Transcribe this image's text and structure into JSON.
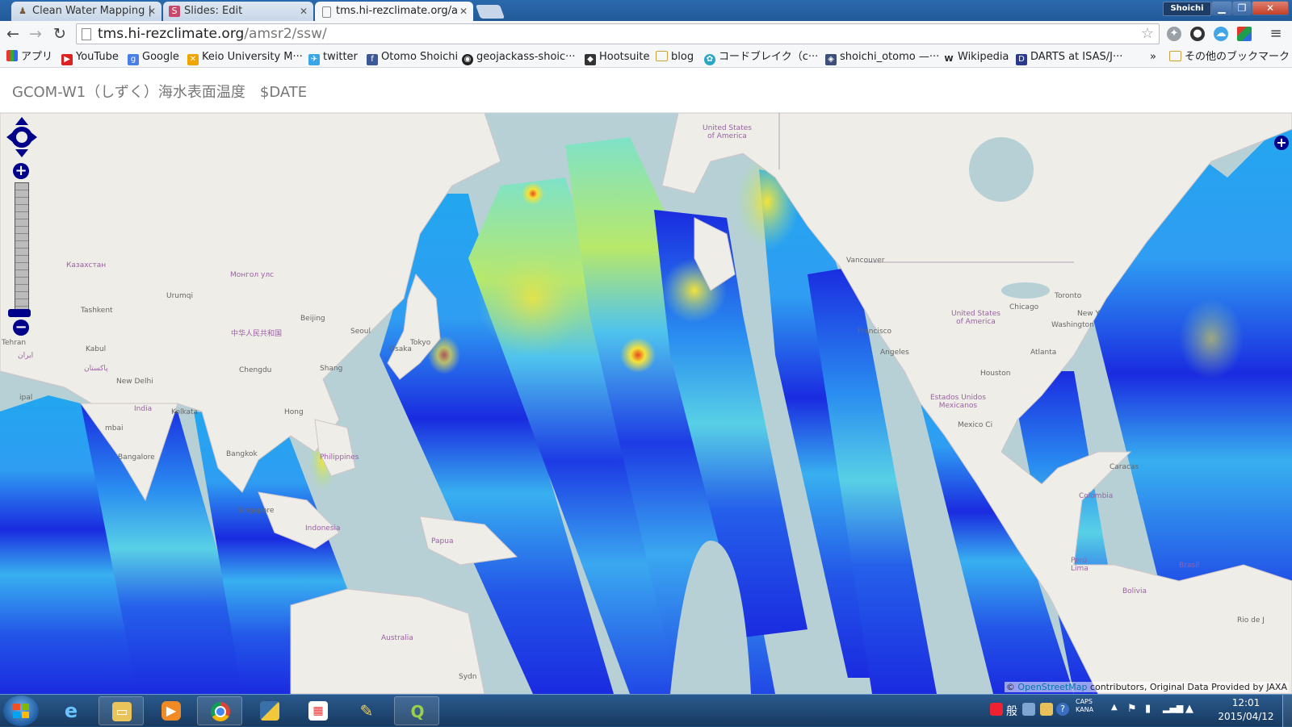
{
  "browser": {
    "tabs": [
      {
        "title": "Clean Water Mapping |",
        "active": false,
        "favicon": "person-icon"
      },
      {
        "title": "Slides: Edit",
        "active": false,
        "favicon": "slides-icon"
      },
      {
        "title": "tms.hi-rezclimate.org/a",
        "active": true,
        "favicon": "page-icon"
      }
    ],
    "user": "Shoichi",
    "url_host": "tms.hi-rezclimate.org",
    "url_path": "/amsr2/ssw/",
    "bookmarks": [
      {
        "label": "アプリ",
        "icon": "apps-icon"
      },
      {
        "label": "YouTube",
        "icon": "youtube-icon"
      },
      {
        "label": "Google",
        "icon": "google-icon"
      },
      {
        "label": "Keio University M···",
        "icon": "keio-icon"
      },
      {
        "label": "twitter",
        "icon": "twitter-icon"
      },
      {
        "label": "Otomo Shoichi",
        "icon": "facebook-icon"
      },
      {
        "label": "geojackass-shoic···",
        "icon": "github-icon"
      },
      {
        "label": "Hootsuite",
        "icon": "hootsuite-icon"
      },
      {
        "label": "blog",
        "icon": "folder-icon"
      },
      {
        "label": "コードブレイク（c···",
        "icon": "codebreak-icon"
      },
      {
        "label": "shoichi_otomo —···",
        "icon": "shield-icon"
      },
      {
        "label": "Wikipedia",
        "icon": "wikipedia-icon"
      },
      {
        "label": "DARTS at ISAS/J···",
        "icon": "darts-icon"
      }
    ],
    "bookmarks_overflow": "»",
    "other_bookmarks": "その他のブックマーク"
  },
  "page": {
    "title": "GCOM-W1（しずく）海水表面温度　$DATE"
  },
  "map": {
    "labels": [
      {
        "text": "United States\nof America",
        "kind": "country"
      },
      {
        "text": "Казахстан",
        "kind": "country"
      },
      {
        "text": "Монгол улс",
        "kind": "country"
      },
      {
        "text": "Urumqi",
        "kind": "city"
      },
      {
        "text": "Tashkent",
        "kind": "city"
      },
      {
        "text": "Beijing",
        "kind": "city"
      },
      {
        "text": "中华人民共和国",
        "kind": "country"
      },
      {
        "text": "Seoul",
        "kind": "city"
      },
      {
        "text": "Tokyo",
        "kind": "city"
      },
      {
        "text": "Osaka",
        "kind": "city"
      },
      {
        "text": "Tehran",
        "kind": "city"
      },
      {
        "text": "ایران",
        "kind": "country"
      },
      {
        "text": "Kabul",
        "kind": "city"
      },
      {
        "text": "پاکستان",
        "kind": "country"
      },
      {
        "text": "New Delhi",
        "kind": "city"
      },
      {
        "text": "Chengdu",
        "kind": "city"
      },
      {
        "text": "Shang",
        "kind": "city"
      },
      {
        "text": "India",
        "kind": "country"
      },
      {
        "text": "Kolkata",
        "kind": "city"
      },
      {
        "text": "Hong",
        "kind": "city"
      },
      {
        "text": "Bangkok",
        "kind": "city"
      },
      {
        "text": "Philippines",
        "kind": "country"
      },
      {
        "text": "Bangalore",
        "kind": "city"
      },
      {
        "text": "Singapore",
        "kind": "city"
      },
      {
        "text": "Indonesia",
        "kind": "country"
      },
      {
        "text": "Papua",
        "kind": "country"
      },
      {
        "text": "Australia",
        "kind": "country"
      },
      {
        "text": "Sydn",
        "kind": "city"
      },
      {
        "text": "Vancouver",
        "kind": "city"
      },
      {
        "text": "Francisco",
        "kind": "city"
      },
      {
        "text": "Angeles",
        "kind": "city"
      },
      {
        "text": "Chicago",
        "kind": "city"
      },
      {
        "text": "Toronto",
        "kind": "city"
      },
      {
        "text": "New Y",
        "kind": "city"
      },
      {
        "text": "Washington",
        "kind": "city"
      },
      {
        "text": "United States\nof America",
        "kind": "country"
      },
      {
        "text": "Atlanta",
        "kind": "city"
      },
      {
        "text": "Houston",
        "kind": "city"
      },
      {
        "text": "Estados Unidos\nMexicanos",
        "kind": "country"
      },
      {
        "text": "Mexico Ci",
        "kind": "city"
      },
      {
        "text": "Caracas",
        "kind": "city"
      },
      {
        "text": "Colombia",
        "kind": "country"
      },
      {
        "text": "Perú\nLima",
        "kind": "country"
      },
      {
        "text": "Brasil",
        "kind": "country"
      },
      {
        "text": "Bolivia",
        "kind": "country"
      },
      {
        "text": "Rio de J",
        "kind": "city"
      },
      {
        "text": "ipal",
        "kind": "city"
      },
      {
        "text": "mbai",
        "kind": "city"
      }
    ],
    "attribution_prefix": "© ",
    "attribution_link": "OpenStreetMap",
    "attribution_suffix": " contributors, Original Data Provided by JAXA",
    "palette": {
      "cold": "#1a2be0",
      "mid": "#22a6f0",
      "warm": "#7ee2c8",
      "hot": "#f4e33a",
      "hottest": "#e84a1a",
      "land": "#efede8",
      "water": "#b7d0d6"
    }
  },
  "taskbar": {
    "apps": [
      {
        "name": "ie",
        "icon": "internet-explorer-icon"
      },
      {
        "name": "explorer",
        "icon": "folder-icon"
      },
      {
        "name": "media",
        "icon": "media-player-icon"
      },
      {
        "name": "chrome",
        "icon": "chrome-icon"
      },
      {
        "name": "python",
        "icon": "python-icon"
      },
      {
        "name": "apps",
        "icon": "tiles-icon"
      },
      {
        "name": "tool",
        "icon": "pen-tool-icon"
      },
      {
        "name": "qgis",
        "icon": "qgis-icon"
      }
    ],
    "ime": "般",
    "caps": "CAPS",
    "kana": "KANA",
    "time": "12:01",
    "date": "2015/04/12"
  }
}
